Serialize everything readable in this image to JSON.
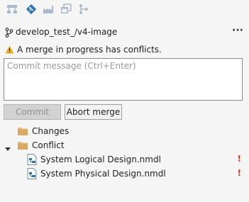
{
  "toolbar": {
    "icons": [
      "hierarchy-icon",
      "git-icon",
      "factory-icon",
      "window-stack-icon",
      "branch-tree-icon"
    ]
  },
  "branch": {
    "name": "develop_test_/v4-image",
    "more_label": "···"
  },
  "warning": {
    "text": "A merge in progress has conflicts."
  },
  "commit": {
    "placeholder": "Commit message (Ctrl+Enter)",
    "value": "",
    "commit_label": "Commit",
    "abort_label": "Abort merge"
  },
  "tree": {
    "changes_label": "Changes",
    "conflict_label": "Conflict",
    "files": [
      {
        "name": "System Logical Design.nmdl",
        "status": "!"
      },
      {
        "name": "System Physical Design.nmdl",
        "status": "!"
      }
    ]
  },
  "colors": {
    "accent": "#2b73b8",
    "disabled_icon": "#a9b9c9",
    "warning": "#e3b21a",
    "conflict": "#d83b1f",
    "folder": "#e3b980"
  }
}
